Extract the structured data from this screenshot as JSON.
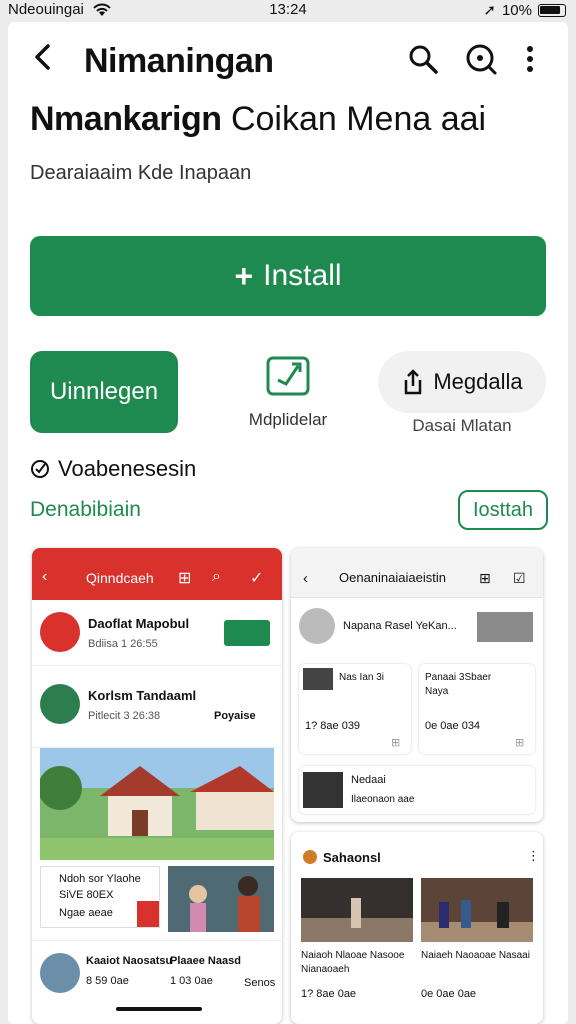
{
  "status": {
    "carrier": "Ndeouingai",
    "time": "13:24",
    "battery": "10%"
  },
  "header": {
    "back_icon": "chevron-left-icon",
    "title": "Nimaningan",
    "icons": [
      "search-icon",
      "zoom-icon",
      "more-vert-icon"
    ]
  },
  "app": {
    "name_bold": "Nmankarign",
    "name_rest": "Coikan Mena aai",
    "subtitle": "Dearaiaaim Kde Inapaan"
  },
  "install": {
    "icon": "+",
    "label": "Install",
    "color": "#1e8a4f"
  },
  "actions": {
    "green_pill": "Uinnlegen",
    "middle_label": "Mdplidelar",
    "grey_pill": "Megdalla",
    "grey_label": "Dasai Mlatan"
  },
  "info": {
    "check_text": "Voabenesesin",
    "link_text": "Denabibiain",
    "outline_button": "Iosttah"
  },
  "screenshot1": {
    "header_title": "Qinndcaeh",
    "rows": [
      {
        "title": "Daoflat Mapobul",
        "meta": "Bdiisa 1 26:55"
      },
      {
        "title": "Korlsm Tandaaml",
        "meta": "Pitlecit 3 26:38",
        "tag": "Poyaise"
      }
    ],
    "tile1": {
      "line1": "Ndoh sor Ylaohe",
      "line2": "SiVE 80EX",
      "line3": "Ngae aeae"
    },
    "bottom": {
      "line1": "Kaaiot Naosatsu",
      "line2": "8 59 0ae",
      "line3": "Plaaee Naasd",
      "line4": "1 03 0ae",
      "badge": "Senos"
    }
  },
  "screenshot2": {
    "header_title": "Oenaninaiaiaeistin",
    "row1": "Napana Rasel YeKan...",
    "card_a": {
      "title": "Nas Ian 3i",
      "meta": "1? 8ae 039"
    },
    "card_b": {
      "title": "Panaai 3Sbaer",
      "sub": "Naya",
      "meta": "0e 0ae 034"
    },
    "row3": {
      "title": "Nedaai",
      "meta": "Ilaeonaon aae"
    }
  },
  "screenshot3": {
    "title": "Sahaonsl",
    "items": [
      {
        "title": "Naiaoh Nlaoae Nasooe",
        "sub": "Nianaoaeh",
        "meta": "1? 8ae 0ae"
      },
      {
        "title": "Naiaeh Naoaoae Nasaai",
        "meta": "0e 0ae 0ae"
      }
    ]
  }
}
